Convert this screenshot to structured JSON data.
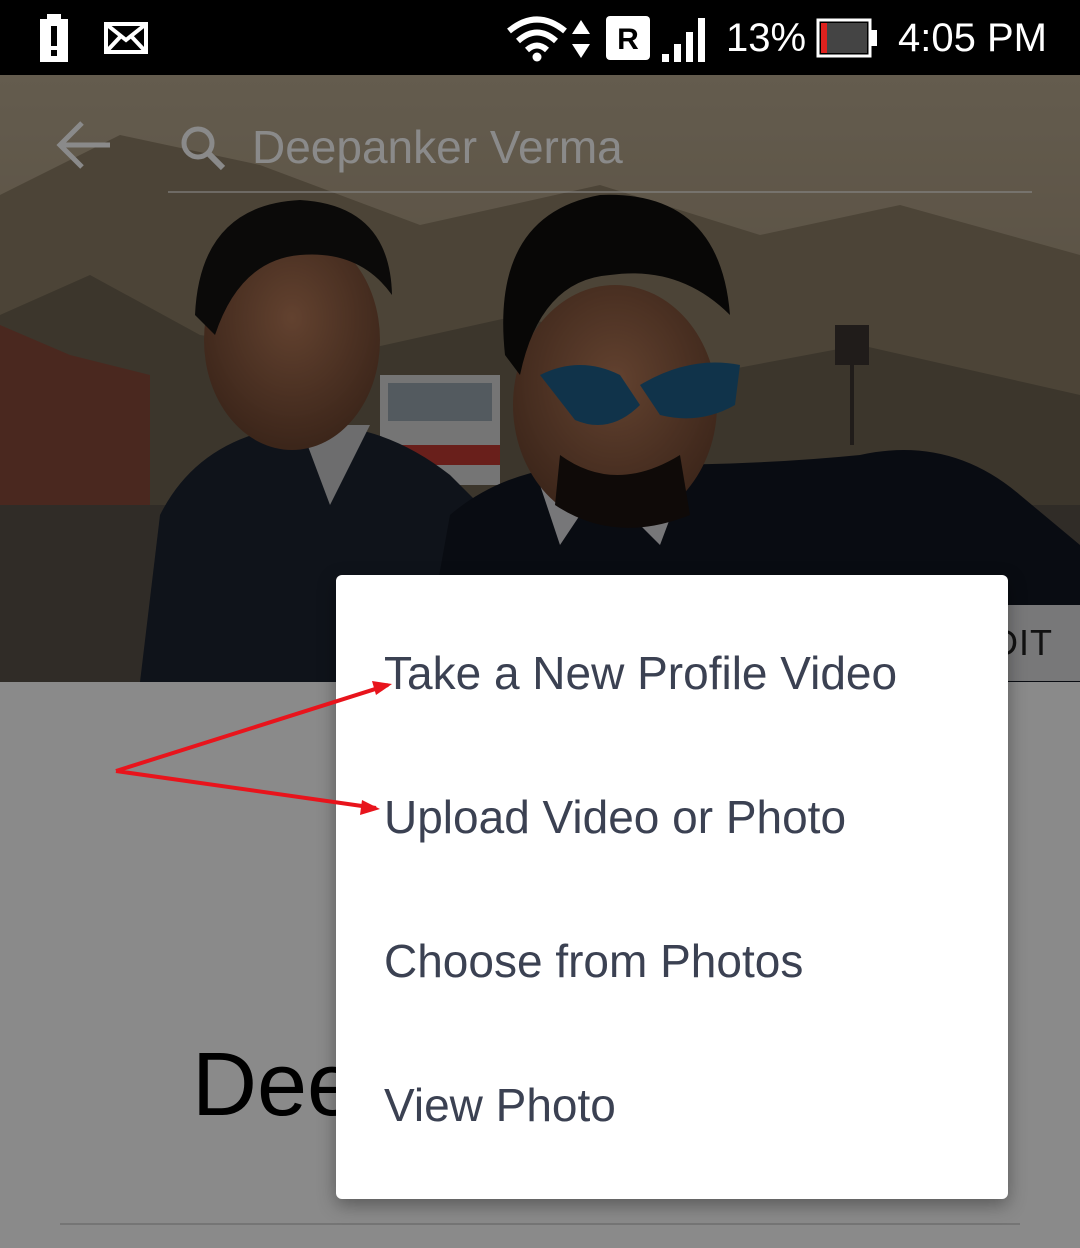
{
  "status_bar": {
    "battery_percent": "13%",
    "time": "4:05 PM",
    "icons": [
      "battery-alert-icon",
      "mail-icon",
      "wifi-icon",
      "data-arrows-icon",
      "roaming-icon",
      "signal-icon",
      "battery-icon"
    ],
    "battery_level": 0.13
  },
  "search": {
    "query": "Deepanker Verma"
  },
  "cover": {
    "edit_label": "EDIT"
  },
  "profile": {
    "name": "Deepanker Verma"
  },
  "menu": {
    "items": [
      {
        "label": "Take a New Profile Video"
      },
      {
        "label": "Upload Video or Photo"
      },
      {
        "label": "Choose from Photos"
      },
      {
        "label": "View Photo"
      }
    ]
  },
  "colors": {
    "menu_text": "#3b4152",
    "annotation_arrow": "#e8141c",
    "battery_low": "#e0221e",
    "overlay": "rgba(0,0,0,0.46)"
  }
}
